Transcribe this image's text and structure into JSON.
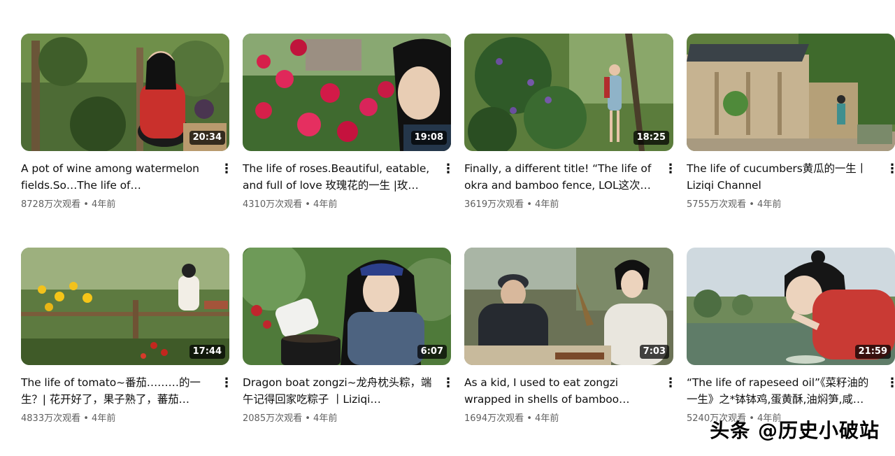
{
  "videos": [
    {
      "title": "A pot of wine among watermelon fields.So…The life of watermelons…",
      "duration": "20:34",
      "views": "8728万次观看",
      "age": "4年前",
      "menu_icon": "⋮"
    },
    {
      "title": "The life of roses.Beautiful, eatable, and full of love 玫瑰花的一生 |玫…",
      "duration": "19:08",
      "views": "4310万次观看",
      "age": "4年前",
      "menu_icon": "⋮"
    },
    {
      "title": "Finally, a different title! “The life of okra and bamboo fence, LOL这次…",
      "duration": "18:25",
      "views": "3619万次观看",
      "age": "4年前",
      "menu_icon": "⋮"
    },
    {
      "title": "The life of cucumbers黄瓜的一生丨 Liziqi Channel",
      "duration": "",
      "views": "5755万次观看",
      "age": "4年前",
      "menu_icon": "⋮"
    },
    {
      "title": "The life of tomato~番茄………的一生？| 花开好了，果子熟了，蕃茄…",
      "duration": "17:44",
      "views": "4833万次观看",
      "age": "4年前",
      "menu_icon": "⋮"
    },
    {
      "title": "Dragon boat zongzi~龙舟枕头粽，端午记得回家吃粽子 丨Liziqi…",
      "duration": "6:07",
      "views": "2085万次观看",
      "age": "4年前",
      "menu_icon": "⋮"
    },
    {
      "title": "As a kid, I used to eat zongzi wrapped in shells of bamboo shoo…",
      "duration": "7:03",
      "views": "1694万次观看",
      "age": "4年前",
      "menu_icon": "⋮"
    },
    {
      "title": "“The life of rapeseed oil”《菜籽油的一生》之*钵钵鸡,蛋黄酥,油焖笋,咸…",
      "duration": "21:59",
      "views": "5240万次观看",
      "age": "4年前",
      "menu_icon": "⋮"
    }
  ],
  "separator": "•",
  "watermark": "头条 @历史小破站"
}
